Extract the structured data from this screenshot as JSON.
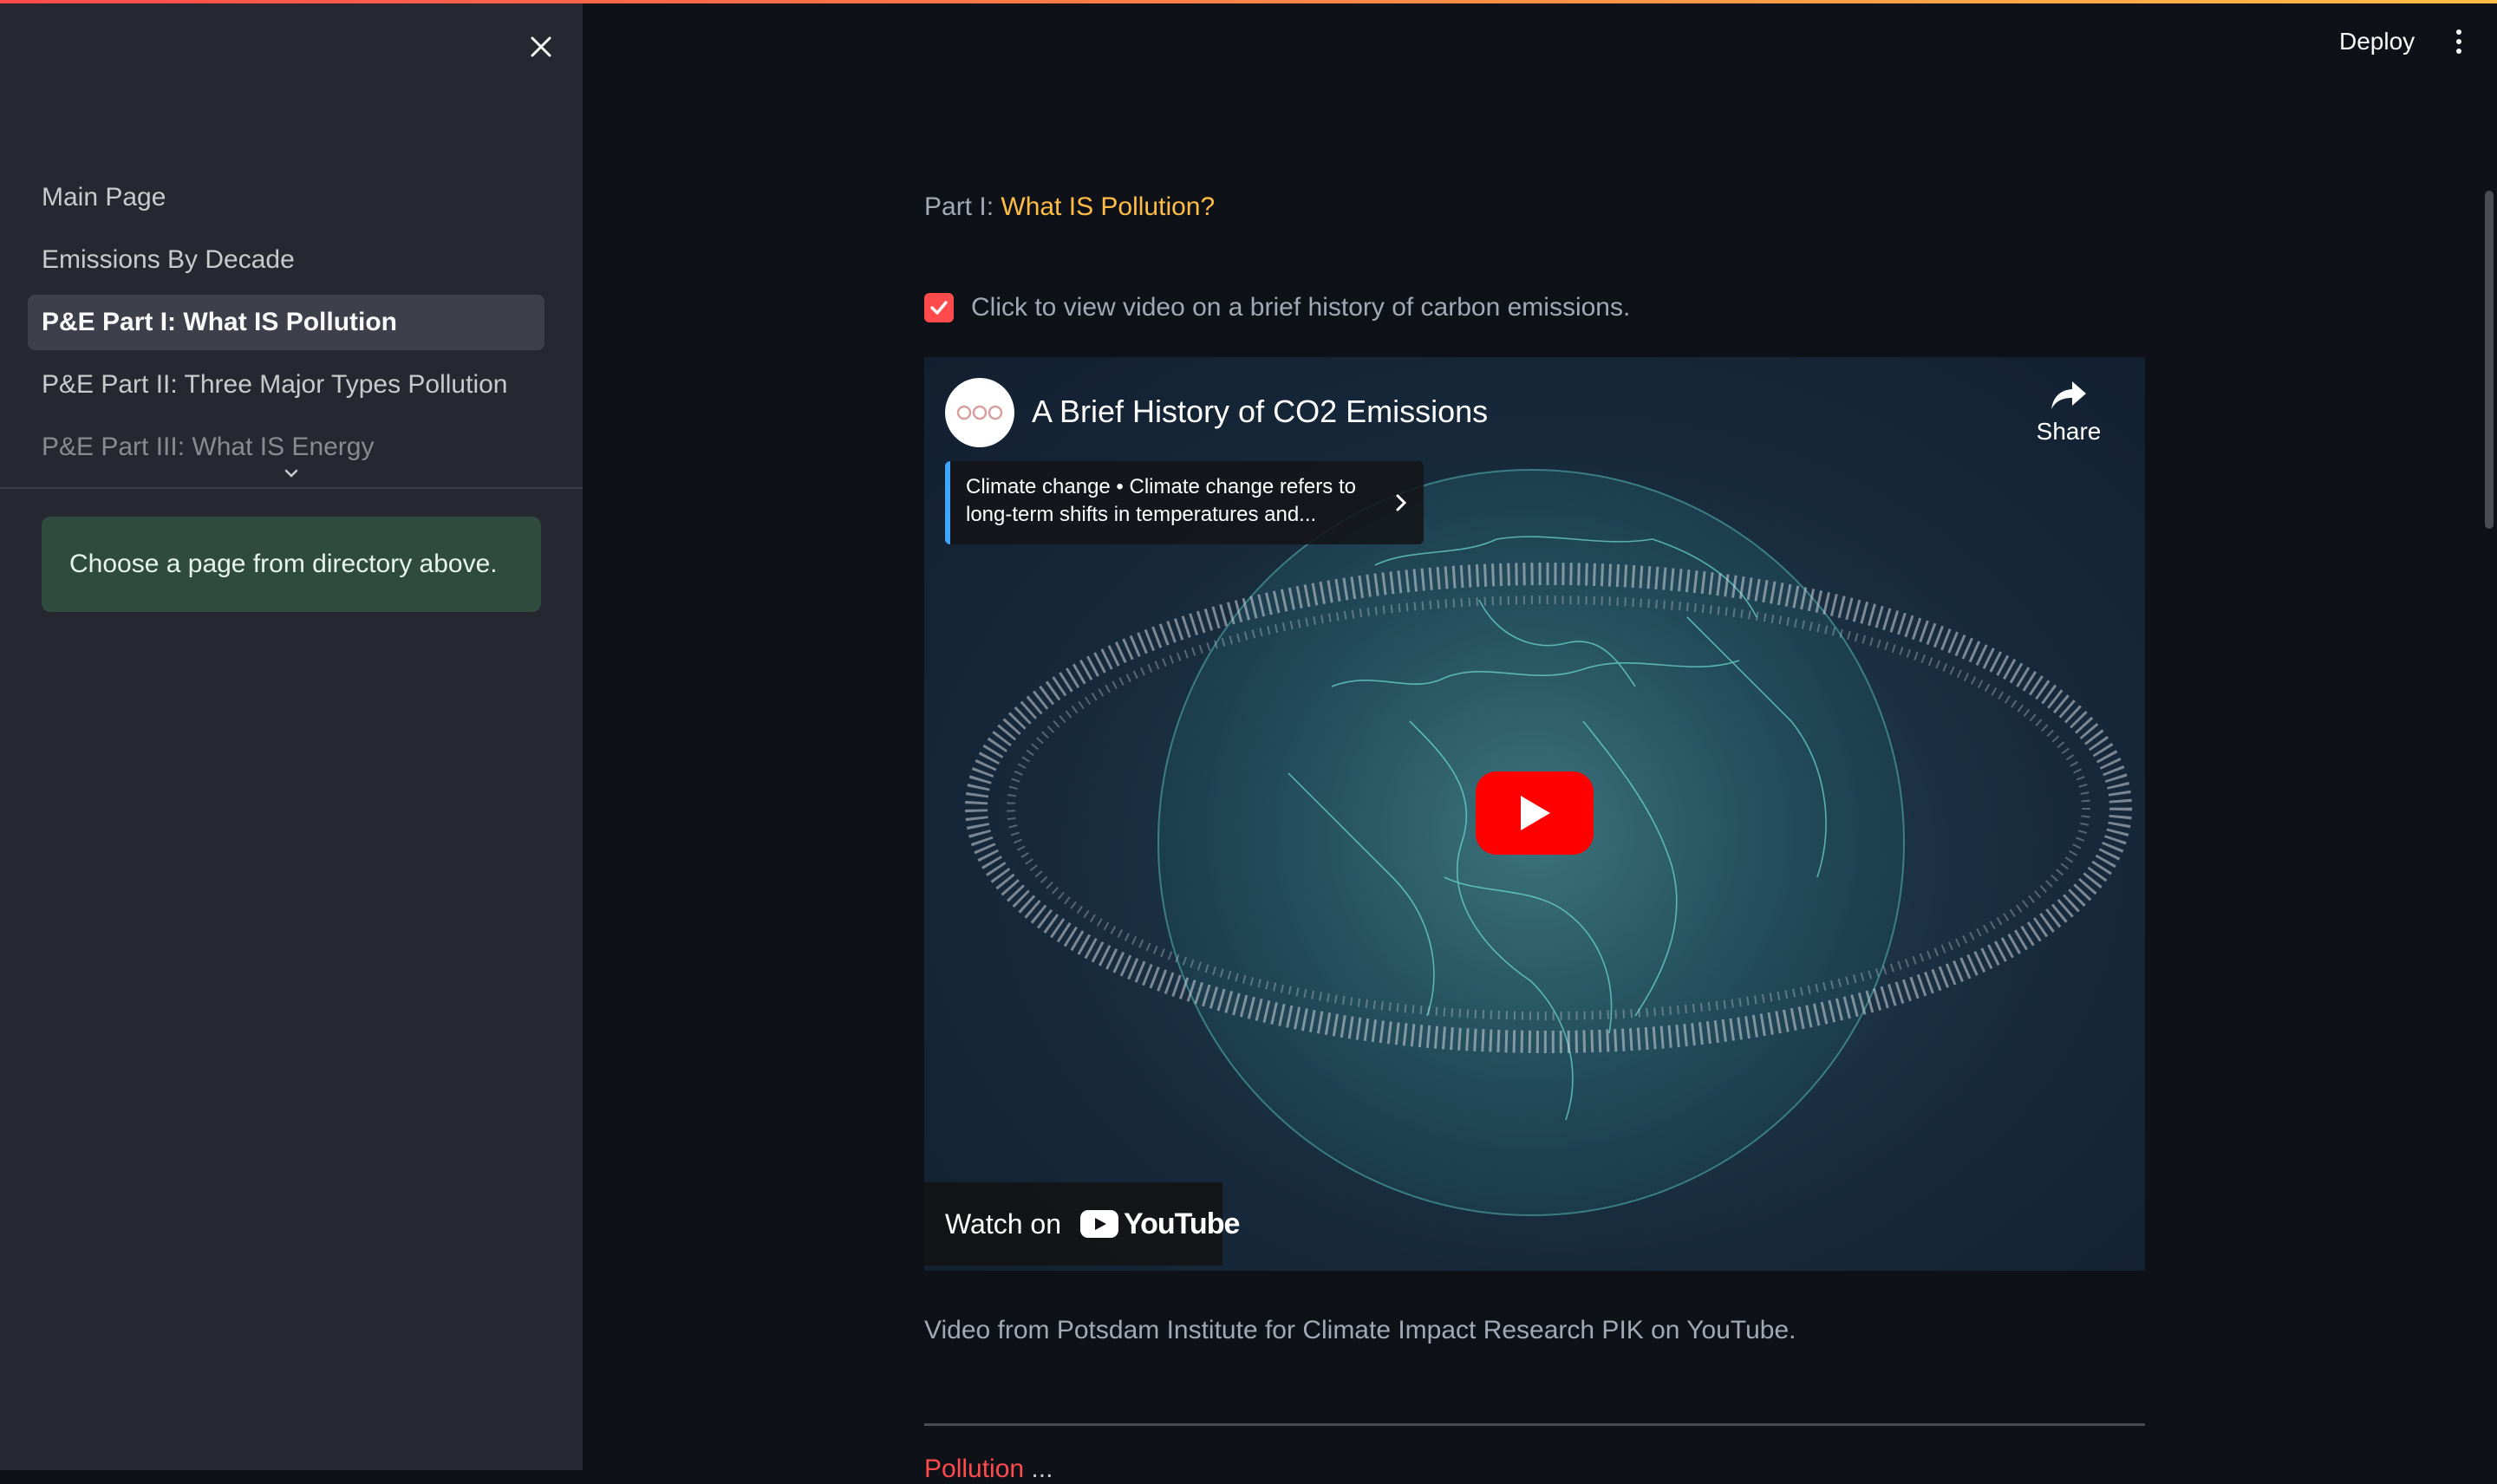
{
  "header": {
    "deploy_label": "Deploy",
    "menu_icon": "kebab-menu-icon"
  },
  "sidebar": {
    "close_icon": "close-icon",
    "items": [
      {
        "label": "Main Page",
        "active": false
      },
      {
        "label": "Emissions By Decade",
        "active": false
      },
      {
        "label": "P&E Part I: What IS Pollution",
        "active": true
      },
      {
        "label": "P&E Part II: Three Major Types Pollution",
        "active": false
      },
      {
        "label": "P&E Part III: What IS Energy",
        "active": false
      }
    ],
    "info_message": "Choose a page from directory above."
  },
  "main": {
    "part_prefix": "Part I:",
    "part_title": "What IS Pollution?",
    "checkbox": {
      "checked": true,
      "label": "Click to view video on a brief history of carbon emissions."
    },
    "video": {
      "title": "A Brief History of CO2 Emissions",
      "share_label": "Share",
      "card_text": "Climate change • Climate change refers to long-term shifts in temperatures and...",
      "watch_on_label": "Watch on",
      "youtube_wordmark": "YouTube"
    },
    "caption": "Video from Potsdam Institute for Climate Impact Research PIK on YouTube.",
    "cut_off_text_red": "Pollution",
    "cut_off_text_rest": " ..."
  },
  "colors": {
    "background": "#0e1117",
    "sidebar": "#262730",
    "accent_red": "#ff4b4b",
    "accent_orange": "#ffbd45",
    "info_green": "#2e4b3d",
    "youtube_red": "#ff0000"
  }
}
